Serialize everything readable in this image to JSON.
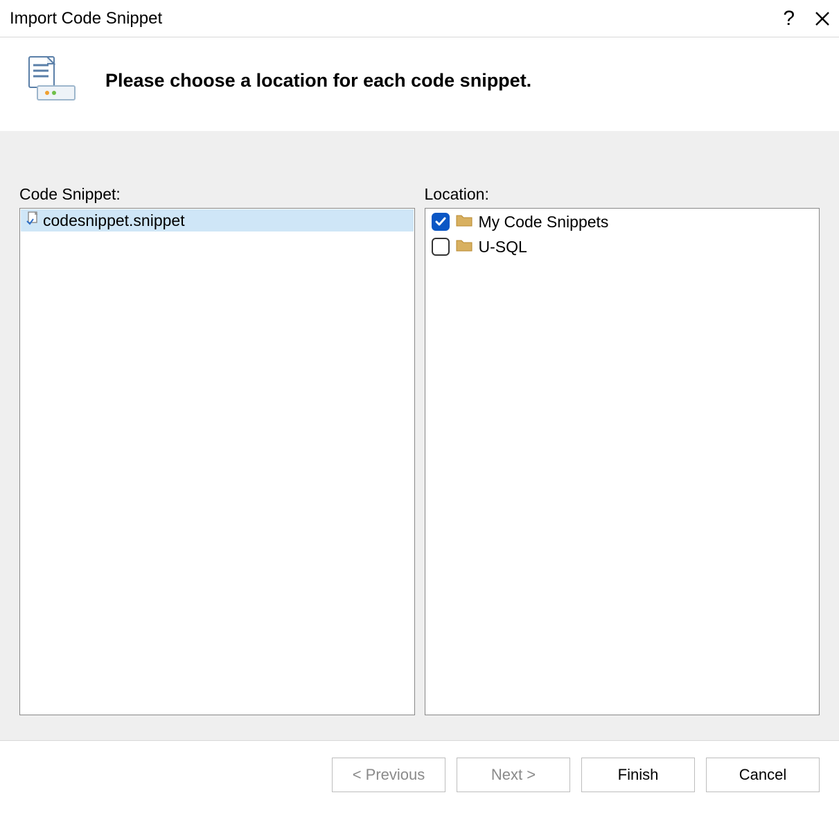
{
  "titlebar": {
    "title": "Import Code Snippet"
  },
  "header": {
    "heading": "Please choose a location for each code snippet."
  },
  "snippet_panel": {
    "label": "Code Snippet:",
    "items": [
      {
        "name": "codesnippet.snippet",
        "selected": true
      }
    ]
  },
  "location_panel": {
    "label": "Location:",
    "items": [
      {
        "name": "My Code Snippets",
        "checked": true
      },
      {
        "name": "U-SQL",
        "checked": false
      }
    ]
  },
  "footer": {
    "previous": "< Previous",
    "next": "Next >",
    "finish": "Finish",
    "cancel": "Cancel"
  }
}
